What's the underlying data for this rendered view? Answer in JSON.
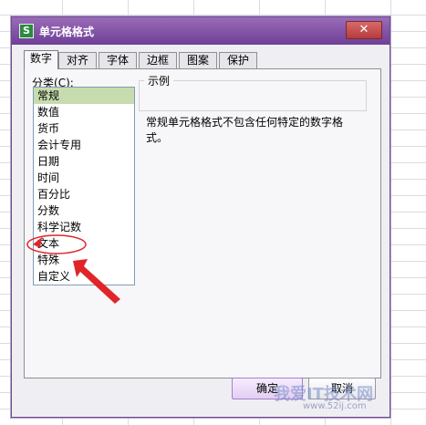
{
  "dialog": {
    "app_icon": "S",
    "title": "单元格格式",
    "close_glyph": "✕"
  },
  "tabs": [
    {
      "label": "数字",
      "active": true
    },
    {
      "label": "对齐",
      "active": false
    },
    {
      "label": "字体",
      "active": false
    },
    {
      "label": "边框",
      "active": false
    },
    {
      "label": "图案",
      "active": false
    },
    {
      "label": "保护",
      "active": false
    }
  ],
  "category": {
    "label": "分类",
    "shortcut": "C",
    "label_suffix": ":",
    "items": [
      "常规",
      "数值",
      "货币",
      "会计专用",
      "日期",
      "时间",
      "百分比",
      "分数",
      "科学记数",
      "文本",
      "特殊",
      "自定义"
    ],
    "selected": "常规"
  },
  "sample": {
    "label": "示例",
    "value": ""
  },
  "description": "常规单元格格式不包含任何特定的数字格式。",
  "buttons": {
    "ok": "确定",
    "cancel": "取消"
  },
  "annotation": {
    "color": "#e0252a",
    "highlight_item": "文本"
  },
  "watermark": {
    "text": "我爱IT技术网",
    "url": "www.52ij.com"
  }
}
